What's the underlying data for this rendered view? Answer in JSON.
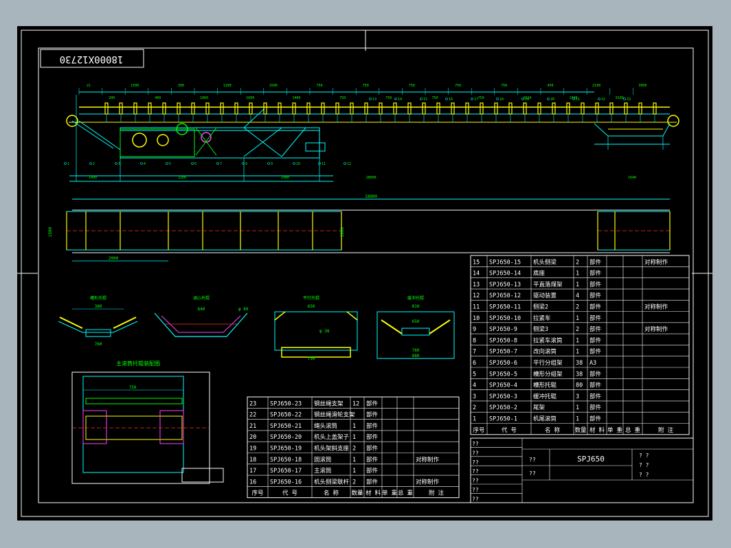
{
  "drawing": {
    "label_box": "18000X12730",
    "dims_top": [
      "21",
      "200",
      "1500",
      "400",
      "300",
      "1060",
      "1100",
      "1000",
      "1500",
      "1400",
      "750",
      "750",
      "750",
      "750",
      "750",
      "750",
      "750",
      "750",
      "750",
      "1524",
      "450",
      "1046",
      "2100",
      "9100",
      "3000"
    ],
    "dims_bottom": [
      "1400",
      "3200",
      "2900",
      "18000",
      "1640"
    ],
    "plan_dims": [
      "18000",
      "2000",
      "1500",
      "1000"
    ],
    "item_labels": [
      "1",
      "2",
      "3",
      "4",
      "5",
      "6",
      "7",
      "8",
      "9",
      "10",
      "11",
      "12",
      "13",
      "14",
      "15",
      "16",
      "17",
      "18",
      "19",
      "20",
      "21",
      "22",
      "23"
    ],
    "detail_titles": [
      "槽形托辊",
      "调心托辊",
      "平行托辊",
      "缓冲托辊"
    ],
    "detail_dims": [
      "380",
      "640",
      "650",
      "810",
      "760",
      "880",
      "650",
      "750",
      "φ 38",
      "φ 89"
    ],
    "section_title": "主滚筒托辊装配图",
    "section_dim": "750"
  },
  "bom_right": {
    "rows": [
      {
        "no": "15",
        "code": "SPJ650-15",
        "name": "机头侧梁",
        "qty": "2",
        "mat": "部件",
        "note": "对称制作"
      },
      {
        "no": "14",
        "code": "SPJ650-14",
        "name": "底座",
        "qty": "1",
        "mat": "部件",
        "note": ""
      },
      {
        "no": "13",
        "code": "SPJ650-13",
        "name": "平直落煤架",
        "qty": "1",
        "mat": "部件",
        "note": ""
      },
      {
        "no": "12",
        "code": "SPJ650-12",
        "name": "驱动装置",
        "qty": "4",
        "mat": "部件",
        "note": ""
      },
      {
        "no": "11",
        "code": "SPJ650-11",
        "name": "侧梁2",
        "qty": "2",
        "mat": "部件",
        "note": "对称制作"
      },
      {
        "no": "10",
        "code": "SPJ650-10",
        "name": "拉紧车",
        "qty": "1",
        "mat": "部件",
        "note": ""
      },
      {
        "no": "9",
        "code": "SPJ650-9",
        "name": "侧梁3",
        "qty": "2",
        "mat": "部件",
        "note": "对称制作"
      },
      {
        "no": "8",
        "code": "SPJ650-8",
        "name": "拉紧车滚筒",
        "qty": "1",
        "mat": "部件",
        "note": ""
      },
      {
        "no": "7",
        "code": "SPJ650-7",
        "name": "改向滚筒",
        "qty": "1",
        "mat": "部件",
        "note": ""
      },
      {
        "no": "6",
        "code": "SPJ650-6",
        "name": "平行分组架",
        "qty": "38",
        "mat": "A3",
        "note": ""
      },
      {
        "no": "5",
        "code": "SPJ650-5",
        "name": "槽形分组架",
        "qty": "38",
        "mat": "部件",
        "note": ""
      },
      {
        "no": "4",
        "code": "SPJ650-4",
        "name": "槽形托辊",
        "qty": "80",
        "mat": "部件",
        "note": ""
      },
      {
        "no": "3",
        "code": "SPJ650-3",
        "name": "缓冲托辊",
        "qty": "3",
        "mat": "部件",
        "note": ""
      },
      {
        "no": "2",
        "code": "SPJ650-2",
        "name": "尾架",
        "qty": "1",
        "mat": "部件",
        "note": ""
      },
      {
        "no": "1",
        "code": "SPJ650-1",
        "name": "机尾滚筒",
        "qty": "1",
        "mat": "部件",
        "note": ""
      }
    ],
    "header": [
      "序号",
      "代 号",
      "名 称",
      "数量",
      "材 料",
      "单 重",
      "总 重",
      "附 注"
    ]
  },
  "bom_left": {
    "rows": [
      {
        "no": "23",
        "code": "SPJ650-23",
        "name": "钢丝绳支架",
        "qty": "12",
        "mat": "部件",
        "note": ""
      },
      {
        "no": "22",
        "code": "SPJ650-22",
        "name": "钢丝绳滑轮支架",
        "qty": "",
        "mat": "部件",
        "note": ""
      },
      {
        "no": "21",
        "code": "SPJ650-21",
        "name": "绳头滚筒",
        "qty": "1",
        "mat": "部件",
        "note": ""
      },
      {
        "no": "20",
        "code": "SPJ650-20",
        "name": "机头上盖架子",
        "qty": "1",
        "mat": "部件",
        "note": ""
      },
      {
        "no": "19",
        "code": "SPJ650-19",
        "name": "机头架斜支座",
        "qty": "2",
        "mat": "部件",
        "note": ""
      },
      {
        "no": "18",
        "code": "SPJ650-18",
        "name": "固滚筒",
        "qty": "1",
        "mat": "部件",
        "note": "对称制作"
      },
      {
        "no": "17",
        "code": "SPJ650-17",
        "name": "主滚筒",
        "qty": "1",
        "mat": "部件",
        "note": ""
      },
      {
        "no": "16",
        "code": "SPJ650-16",
        "name": "机头侧梁联杆",
        "qty": "2",
        "mat": "部件",
        "note": "对称制作"
      }
    ],
    "header": [
      "序号",
      "代 号",
      "名 称",
      "数量",
      "材 料",
      "单 重",
      "总 重",
      "附 注"
    ]
  },
  "title_block": {
    "drawing_no": "SPJ650",
    "placeholders": [
      "??",
      "??",
      "??",
      "??",
      "??",
      "??",
      "??"
    ],
    "qmarks": [
      "? ?",
      "? ?",
      "? ?"
    ]
  }
}
